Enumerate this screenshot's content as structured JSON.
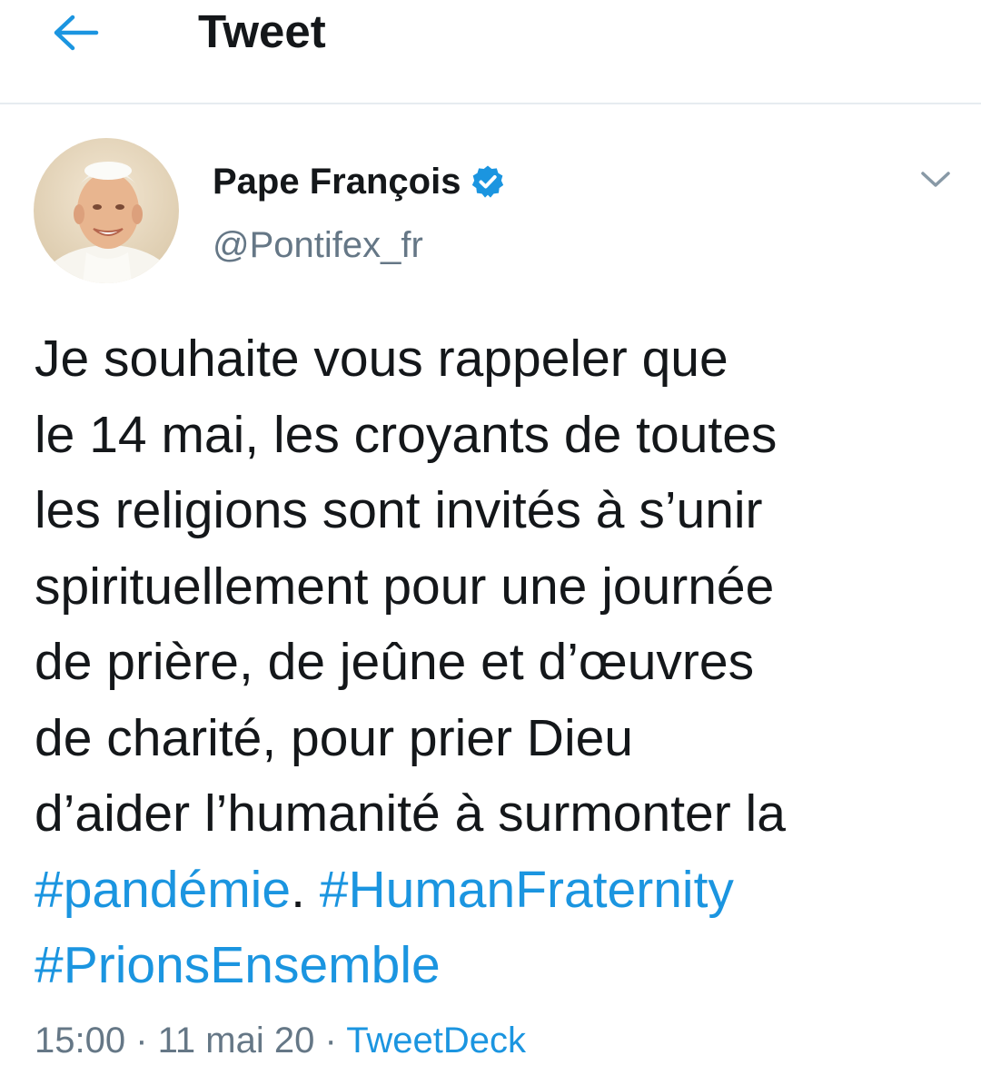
{
  "header": {
    "title": "Tweet",
    "back_icon": "arrow-left-icon"
  },
  "colors": {
    "accent": "#1b95e0",
    "text": "#14171a",
    "secondary_text": "#657786",
    "divider": "#e6ecf0"
  },
  "author": {
    "name": "Pape François",
    "handle": "@Pontifex_fr",
    "verified_icon": "verified-badge-icon",
    "avatar_icon": "avatar-photo",
    "menu_icon": "chevron-down-icon"
  },
  "tweet": {
    "lines": [
      "Je souhaite vous rappeler que",
      "le 14 mai, les croyants de toutes",
      "les religions sont invités à s’unir",
      "spirituellement pour une journée",
      "de prière, de jeûne et d’œuvres",
      "de charité, pour prier Dieu",
      "d’aider l’humanité à surmonter la"
    ],
    "hashtag_pandemie": "#pandémie",
    "period_after_pandemie": ".",
    "hashtag_humanfraternity": "#HumanFraternity",
    "hashtag_prionsensemble": "#PrionsEnsemble"
  },
  "meta": {
    "time": "15:00",
    "date": "11 mai 20",
    "separator": " · ",
    "source": "TweetDeck"
  }
}
